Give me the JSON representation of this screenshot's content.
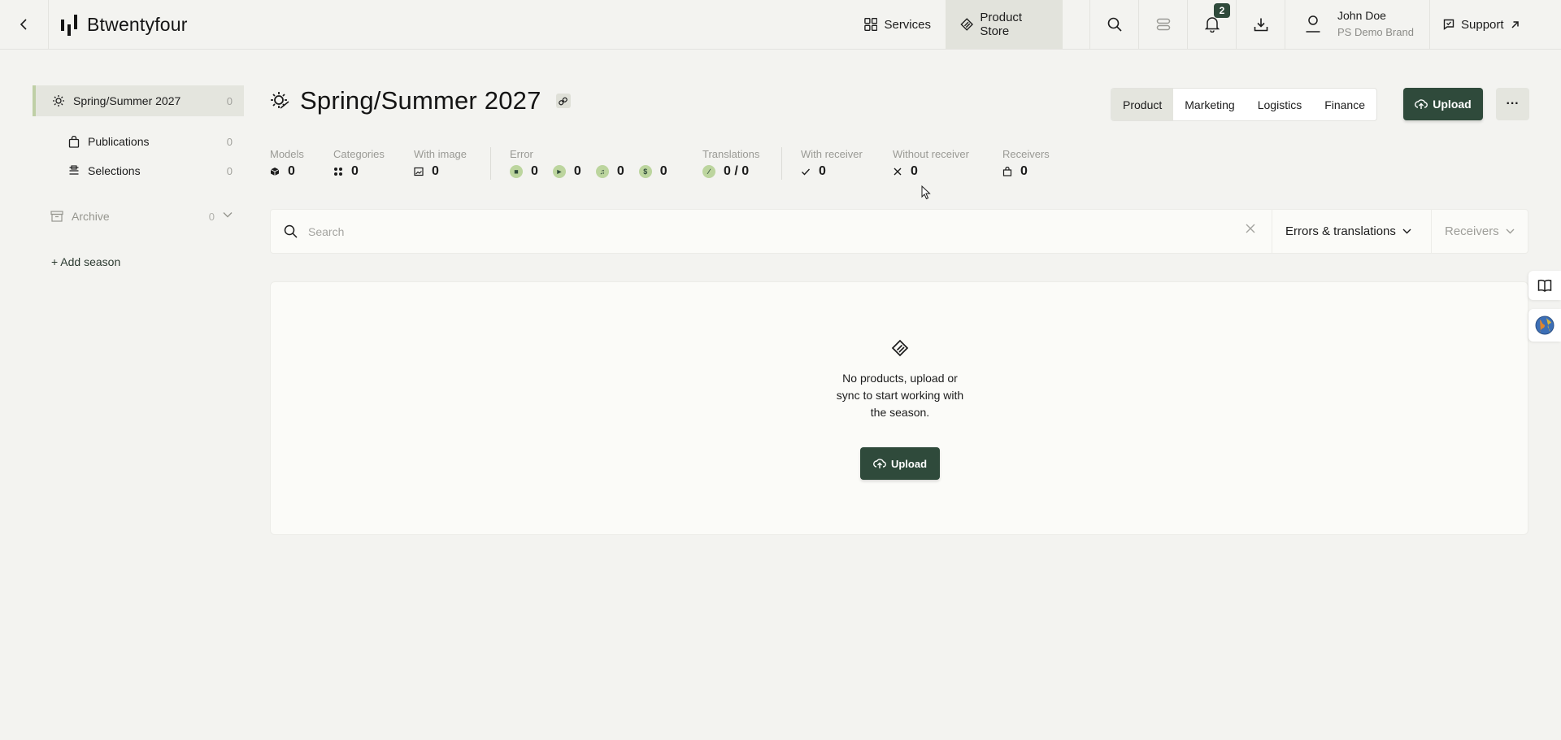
{
  "brand": {
    "name": "Btwentyfour"
  },
  "topnav": {
    "services_label": "Services",
    "product_store_label": "Product Store",
    "notifications_count": "2",
    "user_name": "John Doe",
    "user_brand": "PS Demo Brand",
    "support_label": "Support"
  },
  "sidebar": {
    "season": {
      "label": "Spring/Summer 2027",
      "count": "0"
    },
    "publications": {
      "label": "Publications",
      "count": "0"
    },
    "selections": {
      "label": "Selections",
      "count": "0"
    },
    "archive": {
      "label": "Archive",
      "count": "0"
    },
    "add_season_label": "+ Add season"
  },
  "header": {
    "title": "Spring/Summer 2027",
    "tabs": [
      "Product",
      "Marketing",
      "Logistics",
      "Finance"
    ],
    "active_tab": "Product",
    "upload_label": "Upload",
    "more_label": "···"
  },
  "stats": {
    "models": {
      "label": "Models",
      "value": "0"
    },
    "categories": {
      "label": "Categories",
      "value": "0"
    },
    "with_image": {
      "label": "With image",
      "value": "0"
    },
    "error": {
      "label": "Error",
      "values": [
        "0",
        "0",
        "0",
        "0"
      ]
    },
    "translations": {
      "label": "Translations",
      "value": "0 / 0"
    },
    "with_receiver": {
      "label": "With receiver",
      "value": "0"
    },
    "without_receiver": {
      "label": "Without receiver",
      "value": "0"
    },
    "receivers": {
      "label": "Receivers",
      "value": "0"
    }
  },
  "search": {
    "placeholder": "Search",
    "value": "",
    "filter_errors_label": "Errors & translations",
    "filter_receivers_label": "Receivers"
  },
  "empty_state": {
    "line1": "No products, upload or",
    "line2": "sync to start working with",
    "line3": "the season.",
    "upload_label": "Upload"
  },
  "colors": {
    "accent": "#2f4a3b",
    "highlight": "#bcd59e",
    "background": "#f3f3f0"
  }
}
